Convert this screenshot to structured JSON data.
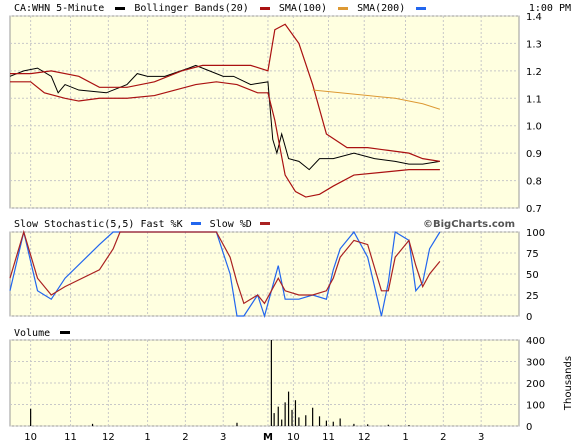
{
  "header": {
    "symbol_label": "CA:WHN 5-Minute",
    "bollinger_label": "Bollinger Bands(20)",
    "sma100_label": "SMA(100)",
    "sma200_label": "SMA(200)",
    "time_label": "1:00 PM"
  },
  "stoch_header": {
    "title": "Slow Stochastic(5,5)",
    "fast_label": "Fast %K",
    "slow_label": "Slow %D"
  },
  "volume_header": {
    "title": "Volume"
  },
  "credit": "©BigCharts.com",
  "volume_unit": "Thousands",
  "colors": {
    "background": "#ffffe0",
    "price": "#000000",
    "bollinger": "#aa1111",
    "sma100": "#aa1111",
    "sma200": "#dd9933",
    "fast_k": "#2266ee",
    "slow_d": "#aa2222",
    "volume": "#000000"
  },
  "chart_data": [
    {
      "type": "line",
      "title": "CA:WHN 5-Minute",
      "ylim": [
        0.7,
        1.4
      ],
      "y_ticks": [
        "1.4",
        "1.3",
        "1.2",
        "1.1",
        "1.0",
        "0.9",
        "0.8",
        "0.7"
      ],
      "series": [
        {
          "name": "CA:WHN",
          "x": [
            0,
            2,
            4,
            6,
            7,
            8,
            10,
            14,
            17,
            18.5,
            20,
            22.5,
            26,
            27,
            29,
            31,
            32.5,
            35,
            37.5,
            38.2,
            38.8,
            39.5,
            40.5,
            42,
            43.5,
            45,
            47,
            50,
            53,
            56,
            58,
            60,
            62.5
          ],
          "values": [
            1.18,
            1.2,
            1.21,
            1.18,
            1.12,
            1.15,
            1.13,
            1.12,
            1.15,
            1.19,
            1.18,
            1.18,
            1.21,
            1.22,
            1.2,
            1.18,
            1.18,
            1.15,
            1.16,
            0.95,
            0.9,
            0.97,
            0.88,
            0.87,
            0.84,
            0.88,
            0.88,
            0.9,
            0.88,
            0.87,
            0.86,
            0.86,
            0.87
          ]
        },
        {
          "name": "Bollinger Bands(20)",
          "x": [
            0,
            3,
            6,
            10,
            13,
            17,
            21,
            25,
            28,
            32,
            35,
            37.5,
            38.5,
            40,
            42,
            44,
            46,
            49,
            52,
            55,
            58,
            60,
            62.5
          ],
          "values": [
            1.19,
            1.19,
            1.2,
            1.18,
            1.14,
            1.14,
            1.16,
            1.2,
            1.22,
            1.22,
            1.22,
            1.2,
            1.35,
            1.37,
            1.3,
            1.15,
            0.97,
            0.92,
            0.92,
            0.91,
            0.9,
            0.88,
            0.87
          ]
        },
        {
          "name": "Bollinger Bands(20) lower",
          "x": [
            0,
            3,
            5,
            8,
            10,
            13,
            17,
            21,
            24,
            27,
            30,
            33,
            36,
            37.5,
            38.5,
            40,
            41.5,
            43,
            45,
            47,
            50,
            54,
            58,
            60,
            62.5
          ],
          "values": [
            1.16,
            1.16,
            1.12,
            1.1,
            1.09,
            1.1,
            1.1,
            1.11,
            1.13,
            1.15,
            1.16,
            1.15,
            1.12,
            1.12,
            1.02,
            0.82,
            0.76,
            0.74,
            0.75,
            0.78,
            0.82,
            0.83,
            0.84,
            0.84,
            0.84
          ]
        },
        {
          "name": "SMA(200)",
          "x": [
            44,
            48,
            52,
            56,
            60,
            62.5
          ],
          "values": [
            1.13,
            1.12,
            1.11,
            1.1,
            1.08,
            1.06
          ]
        }
      ],
      "x_ticks": [
        "10",
        "11",
        "12",
        "1",
        "2",
        "3",
        "M",
        "10",
        "11",
        "12",
        "1",
        "2",
        "3"
      ]
    },
    {
      "type": "line",
      "title": "Slow Stochastic(5,5)",
      "ylim": [
        0,
        100
      ],
      "y_ticks": [
        "100",
        "75",
        "50",
        "25",
        "0"
      ],
      "series": [
        {
          "name": "Fast %K",
          "x": [
            0,
            2,
            4,
            6,
            8,
            13,
            15,
            16,
            18,
            30,
            32,
            33,
            34,
            36,
            37,
            38,
            39,
            40,
            42,
            44,
            46,
            47,
            48,
            50,
            52,
            54,
            55,
            56,
            58,
            59,
            60,
            61,
            62.5
          ],
          "values": [
            30,
            100,
            30,
            20,
            45,
            85,
            100,
            100,
            100,
            100,
            50,
            0,
            0,
            25,
            0,
            30,
            60,
            20,
            20,
            25,
            20,
            55,
            80,
            100,
            70,
            0,
            40,
            100,
            90,
            30,
            40,
            80,
            100
          ]
        },
        {
          "name": "Slow %D",
          "x": [
            0,
            2,
            4,
            6,
            8,
            13,
            15,
            16,
            18,
            30,
            32,
            33,
            34,
            36,
            37,
            38,
            39,
            40,
            42,
            44,
            46,
            47,
            48,
            50,
            52,
            54,
            55,
            56,
            58,
            59,
            60,
            61,
            62.5
          ],
          "values": [
            45,
            100,
            45,
            25,
            35,
            55,
            80,
            100,
            100,
            100,
            70,
            40,
            15,
            25,
            15,
            30,
            45,
            30,
            25,
            25,
            30,
            45,
            70,
            90,
            85,
            30,
            30,
            70,
            90,
            60,
            35,
            50,
            65
          ]
        }
      ]
    },
    {
      "type": "bar",
      "title": "Volume",
      "ylabel": "Thousands",
      "ylim": [
        0,
        400
      ],
      "y_ticks": [
        "400",
        "300",
        "200",
        "100",
        "0"
      ],
      "x": [
        3,
        12,
        33,
        38,
        38.4,
        39,
        39.5,
        40,
        40.5,
        41,
        41.5,
        42,
        43,
        44,
        45,
        46,
        47,
        48,
        50,
        52,
        55,
        58
      ],
      "values": [
        80,
        10,
        15,
        400,
        60,
        90,
        30,
        110,
        160,
        75,
        120,
        40,
        50,
        85,
        45,
        25,
        20,
        35,
        10,
        8,
        6,
        4
      ]
    }
  ]
}
